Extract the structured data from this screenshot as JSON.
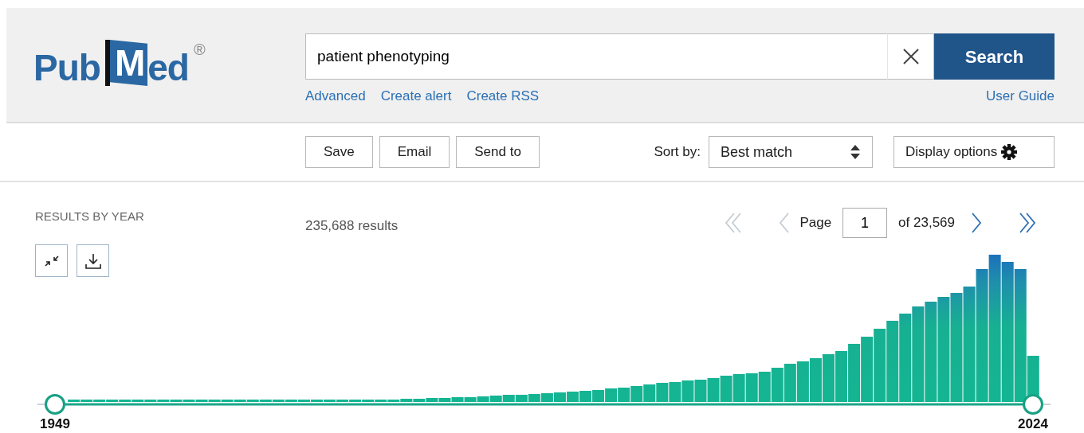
{
  "logo": {
    "parts": [
      "Pub",
      "M",
      "ed"
    ],
    "mark": "®"
  },
  "search": {
    "value": "patient phenotyping",
    "button": "Search"
  },
  "search_links": [
    {
      "label": "Advanced"
    },
    {
      "label": "Create alert"
    },
    {
      "label": "Create RSS"
    }
  ],
  "user_guide": "User Guide",
  "actions": [
    "Save",
    "Email",
    "Send to"
  ],
  "sort": {
    "label": "Sort by:",
    "value": "Best match"
  },
  "display_options": "Display options",
  "results_by_year": {
    "title": "RESULTS BY YEAR",
    "slider": {
      "start": {
        "level": 0,
        "label": "1949"
      },
      "end": {
        "level": 1,
        "label": "2024"
      }
    }
  },
  "results_count": "235,688 results",
  "pagination": {
    "first": {
      "disabled": true
    },
    "previous": {
      "disabled": true
    },
    "page_label": "Page",
    "page": "1",
    "total": "of 23,569",
    "next": {
      "disabled": false
    },
    "last": {
      "disabled": false
    }
  }
}
